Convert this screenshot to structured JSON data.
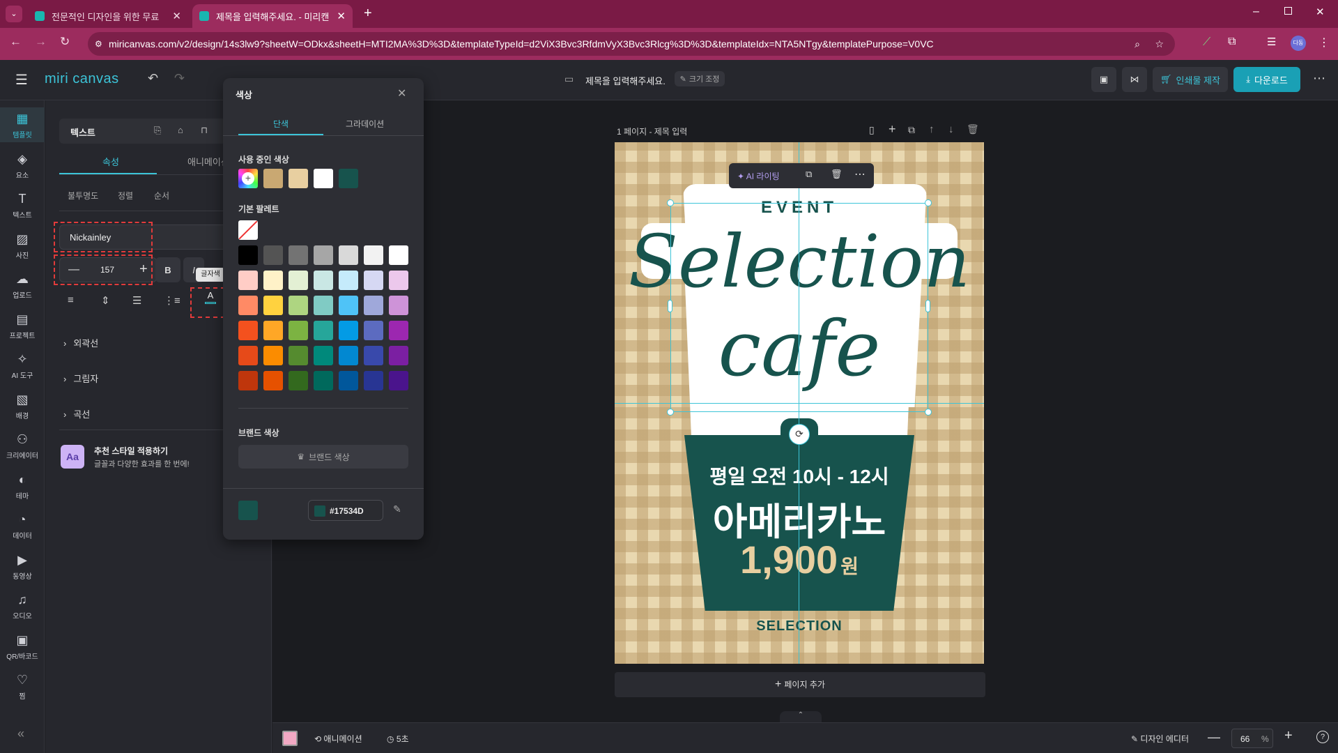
{
  "browser": {
    "tabs": [
      {
        "label": "전문적인 디자인을 위한 무료 ",
        "active": false
      },
      {
        "label": "제목을 입력해주세요. - 미리캔",
        "active": true
      }
    ],
    "url": "miricanvas.com/v2/design/14s3lw9?sheetW=ODkx&sheetH=MTI2MA%3D%3D&templateTypeId=d2ViX3Bvc3RfdmVyX3Bvc3Rlcg%3D%3D&templateIdx=NTA5NTgy&templatePurpose=V0VC",
    "profile_badge": "다동"
  },
  "header": {
    "logo": "miri canvas",
    "doc_title": "제목을 입력해주세요.",
    "resize_label": "크기 조정",
    "print_label": "인쇄물 제작",
    "download_label": "다운로드"
  },
  "rail": [
    {
      "label": "템플릿",
      "icon": "template-icon",
      "active": true
    },
    {
      "label": "요소",
      "icon": "elements-icon"
    },
    {
      "label": "텍스트",
      "icon": "text-icon"
    },
    {
      "label": "사진",
      "icon": "photo-icon"
    },
    {
      "label": "업로드",
      "icon": "upload-icon"
    },
    {
      "label": "프로젝트",
      "icon": "project-icon"
    },
    {
      "label": "AI 도구",
      "icon": "ai-tools-icon"
    },
    {
      "label": "배경",
      "icon": "background-icon"
    },
    {
      "label": "크리에이터",
      "icon": "creator-icon"
    },
    {
      "label": "테마",
      "icon": "theme-icon"
    },
    {
      "label": "데이터",
      "icon": "data-icon"
    },
    {
      "label": "동영상",
      "icon": "video-icon"
    },
    {
      "label": "오디오",
      "icon": "audio-icon"
    },
    {
      "label": "QR/바코드",
      "icon": "qr-icon"
    },
    {
      "label": "찜",
      "icon": "heart-icon"
    }
  ],
  "props": {
    "type_label": "텍스트",
    "tab_props": "속성",
    "tab_anim": "애니메이션",
    "sub_opacity": "불투명도",
    "sub_align": "정렬",
    "sub_order": "순서",
    "font_name": "Nickainley",
    "font_size": "157",
    "bold": "B",
    "italic": "I",
    "tooltip": "글자색",
    "color_btn": "A",
    "outline": "외곽선",
    "shadow": "그림자",
    "curve": "곡선",
    "style_title": "추천 스타일 적용하기",
    "style_desc": "글꼴과 다양한 효과를 한 번에!",
    "style_badge": "Aa"
  },
  "colorpop": {
    "title": "색상",
    "tab_solid": "단색",
    "tab_gradient": "그라데이션",
    "used_label": "사용 중인 색상",
    "used_colors": [
      "#c9a872",
      "#e8cfa0",
      "#ffffff",
      "#17534d"
    ],
    "palette_label": "기본 팔레트",
    "palette": [
      [
        "#000000",
        "#545454",
        "#737373",
        "#a6a6a6",
        "#d9d9d9",
        "#f2f2f2",
        "#ffffff"
      ],
      [
        "#ffcdc6",
        "#fff2c8",
        "#e3f0d4",
        "#c9e7e4",
        "#c5ebfb",
        "#d6d8f3",
        "#ecc8ec"
      ],
      [
        "#ff8a65",
        "#ffd23f",
        "#aed581",
        "#80cbc4",
        "#4fc3f7",
        "#9fa8da",
        "#ce93d8"
      ],
      [
        "#f4511e",
        "#ffa726",
        "#7cb342",
        "#26a69a",
        "#039be5",
        "#5c6bc0",
        "#9c27b0"
      ],
      [
        "#e64a19",
        "#fb8c00",
        "#558b2f",
        "#00897b",
        "#0288d1",
        "#3949ab",
        "#7b1fa2"
      ],
      [
        "#bf360c",
        "#e65100",
        "#33691e",
        "#00695c",
        "#01579b",
        "#283593",
        "#4a148c"
      ]
    ],
    "brand_label": "브랜드 색상",
    "brand_button": "브랜드 색상",
    "current_color": "#17534D",
    "current_hex": "#17534d"
  },
  "canvas": {
    "page_label": "1 페이지 - 제목 입력",
    "ai_writing": "AI 라이팅",
    "add_page": "페이지 추가"
  },
  "poster": {
    "event": "EVENT",
    "line1": "Selection",
    "line2": "cafe",
    "time": "평일 오전 10시 - 12시",
    "menu": "아메리카노",
    "price": "1,900",
    "won": "원",
    "footer": "SELECTION",
    "bg": "#e9d8b0",
    "green": "#17534d",
    "gold": "#e8cfa0"
  },
  "bottom": {
    "animation": "애니메이션",
    "duration": "5초",
    "design_editor": "디자인 에디터",
    "zoom": "66",
    "zoom_unit": "%"
  }
}
